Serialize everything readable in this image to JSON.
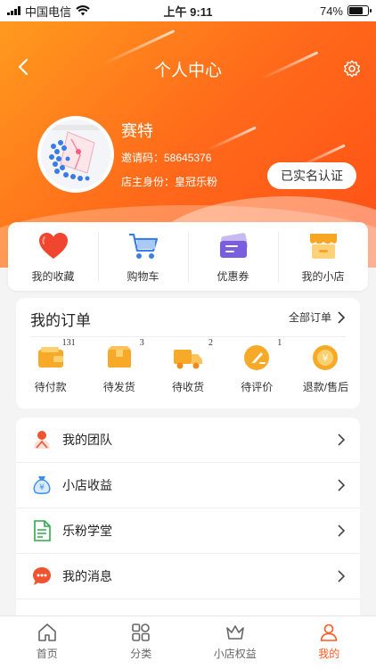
{
  "status_bar": {
    "carrier": "中国电信",
    "time": "上午 9:11",
    "battery_text": "74%",
    "battery_level": 0.74
  },
  "header": {
    "title": "个人中心",
    "username": "赛特",
    "invite_text": "邀请码：58645376",
    "identity_text": "店主身份：皇冠乐粉",
    "verify_label": "已实名认证"
  },
  "quick_links": [
    {
      "label": "我的收藏",
      "icon": "heart-icon"
    },
    {
      "label": "购物车",
      "icon": "cart-icon"
    },
    {
      "label": "优惠券",
      "icon": "coupon-icon"
    },
    {
      "label": "我的小店",
      "icon": "store-icon"
    }
  ],
  "orders": {
    "title": "我的订单",
    "all_label": "全部订单",
    "items": [
      {
        "label": "待付款",
        "badge": "131",
        "icon": "wallet-icon"
      },
      {
        "label": "待发货",
        "badge": "3",
        "icon": "package-icon"
      },
      {
        "label": "待收货",
        "badge": "2",
        "icon": "truck-icon"
      },
      {
        "label": "待评价",
        "badge": "1",
        "icon": "pen-icon"
      },
      {
        "label": "退款/售后",
        "badge": "",
        "icon": "refund-icon"
      }
    ]
  },
  "menu": [
    {
      "label": "我的团队",
      "icon": "team-icon"
    },
    {
      "label": "小店收益",
      "icon": "money-bag-icon"
    },
    {
      "label": "乐粉学堂",
      "icon": "document-icon"
    },
    {
      "label": "我的消息",
      "icon": "message-icon"
    }
  ],
  "tabbar": [
    {
      "label": "首页",
      "icon": "home-icon",
      "active": false
    },
    {
      "label": "分类",
      "icon": "category-icon",
      "active": false
    },
    {
      "label": "小店权益",
      "icon": "crown-icon",
      "active": false
    },
    {
      "label": "我的",
      "icon": "user-icon",
      "active": true
    }
  ],
  "colors": {
    "accent": "#ff5a1f",
    "header_start": "#ff9a1e",
    "header_end": "#ff4f17"
  }
}
